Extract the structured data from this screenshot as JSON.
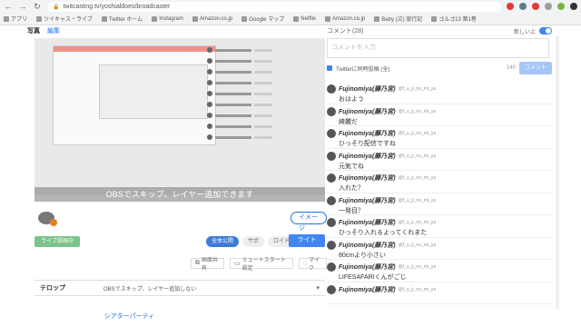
{
  "browser": {
    "url": "twitcasting.tv/yoshialdoes/broadcaster",
    "bookmarks": [
      "アプリ",
      "ツイキャス・ライブ",
      "Twitter ホーム",
      "Instagram",
      "Amazon.co.jp",
      "Google マップ",
      "Netflix",
      "Amazon.co.jp",
      "Baby (泣) 旅行記",
      "ゴルゴ13 第1巻"
    ],
    "ext_colors": [
      "#e53935",
      "#607d8b",
      "#e53935",
      "#9e9e9e",
      "#7cb342",
      "#333333"
    ]
  },
  "left": {
    "tab_photo": "写真",
    "tab_edit": "編集",
    "banner": "OBSでスキップ、レイヤー追加できます",
    "image_button": "イメージ",
    "record_button": "ライブ録画中",
    "pills": [
      "全体公開",
      "サポ",
      "ロイド"
    ],
    "submit": "ライト",
    "tools": [
      {
        "icon": "⧉",
        "label": "画面共有"
      },
      {
        "icon": "▭",
        "label": "ミュートスタート設定"
      },
      {
        "icon": "◌",
        "label": "マイク"
      }
    ],
    "telop_label": "テロップ",
    "telop_value": "OBSでスキップ、レイヤー追加しない",
    "party_link": "シアターパーティ"
  },
  "right": {
    "header": "コメント(28)",
    "toggle_label": "新しい上",
    "input_placeholder": "コメントを入力",
    "compose_label": "Twitterに同時投稿 (全)",
    "char_count": "140",
    "send": "コメント",
    "comments": [
      {
        "name": "Fujinomiya(藤乃宮)",
        "meta": "@f_u_ji_no_mi_ya",
        "text": "おはよう"
      },
      {
        "name": "Fujinomiya(藤乃宮)",
        "meta": "@f_u_ji_no_mi_ya",
        "text": "綺麗だ"
      },
      {
        "name": "Fujinomiya(藤乃宮)",
        "meta": "@f_u_ji_no_mi_ya",
        "text": "ひっそり配信ですね"
      },
      {
        "name": "Fujinomiya(藤乃宮)",
        "meta": "@f_u_ji_no_mi_ya",
        "text": "元気でね"
      },
      {
        "name": "Fujinomiya(藤乃宮)",
        "meta": "@f_u_ji_no_mi_ya",
        "text": "入れた？"
      },
      {
        "name": "Fujinomiya(藤乃宮)",
        "meta": "@f_u_ji_no_mi_ya",
        "text": "一発目？"
      },
      {
        "name": "Fujinomiya(藤乃宮)",
        "meta": "@f_u_ji_no_mi_ya",
        "text": "ひっそり入れるよってくれまた"
      },
      {
        "name": "Fujinomiya(藤乃宮)",
        "meta": "@f_u_ji_no_mi_ya",
        "text": "80cmより小さい"
      },
      {
        "name": "Fujinomiya(藤乃宮)",
        "meta": "@f_u_ji_no_mi_ya",
        "text": "LIFESAFARIくんがごじ"
      },
      {
        "name": "Fujinomiya(藤乃宮)",
        "meta": "@f_u_ji_no_mi_ya",
        "text": ""
      }
    ]
  }
}
